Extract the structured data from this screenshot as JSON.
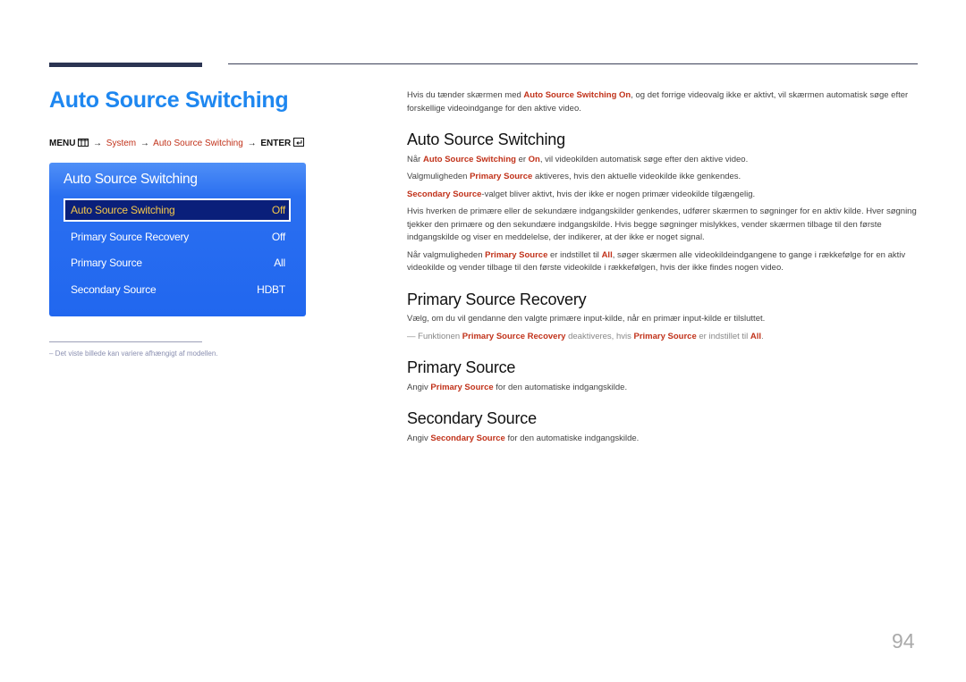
{
  "page_title": "Auto Source Switching",
  "menu_path": {
    "menu": "MENU",
    "system": "System",
    "item": "Auto Source Switching",
    "enter": "ENTER",
    "arrow": "→"
  },
  "osd": {
    "title": "Auto Source Switching",
    "rows": [
      {
        "label": "Auto Source Switching",
        "value": "Off",
        "selected": true
      },
      {
        "label": "Primary Source Recovery",
        "value": "Off"
      },
      {
        "label": "Primary Source",
        "value": "All"
      },
      {
        "label": "Secondary Source",
        "value": "HDBT"
      }
    ]
  },
  "footnote": "‒  Det viste billede kan variere afhængigt af modellen.",
  "intro": {
    "t1": "Hvis du tænder skærmen med ",
    "h1": "Auto Source Switching On",
    "t2": ", og det forrige videovalg ikke er aktivt, vil skærmen automatisk søge efter forskellige videoindgange for den aktive video."
  },
  "sections": {
    "auto": {
      "heading": "Auto Source Switching",
      "p1": {
        "a": "Når ",
        "b": "Auto Source Switching",
        "c": " er ",
        "d": "On",
        "e": ", vil videokilden automatisk søge efter den aktive video."
      },
      "p2": {
        "a": "Valgmuligheden ",
        "b": "Primary Source",
        "c": " aktiveres, hvis den aktuelle videokilde ikke genkendes."
      },
      "p3": {
        "a": "Secondary Source",
        "b": "-valget bliver aktivt, hvis der ikke er nogen primær videokilde tilgængelig."
      },
      "p4": "Hvis hverken de primære eller de sekundære indgangskilder genkendes, udfører skærmen to søgninger for en aktiv kilde. Hver søgning tjekker den primære og den sekundære indgangskilde. Hvis begge søgninger mislykkes, vender skærmen tilbage til den første indgangskilde og viser en meddelelse, der indikerer, at der ikke er noget signal.",
      "p5": {
        "a": "Når valgmuligheden ",
        "b": "Primary Source",
        "c": " er indstillet til ",
        "d": "All",
        "e": ", søger skærmen alle videokildeindgangene to gange i rækkefølge for en aktiv videokilde og vender tilbage til den første videokilde i rækkefølgen, hvis der ikke findes nogen video."
      }
    },
    "recovery": {
      "heading": "Primary Source Recovery",
      "p1": "Vælg, om du vil gendanne den valgte primære input-kilde, når en primær input-kilde er tilsluttet.",
      "note": {
        "dash": "―",
        "a": " Funktionen ",
        "b": "Primary Source Recovery",
        "c": " deaktiveres, hvis ",
        "d": "Primary Source",
        "e": " er indstillet til ",
        "f": "All",
        "g": "."
      }
    },
    "primary": {
      "heading": "Primary Source",
      "p1": {
        "a": "Angiv ",
        "b": "Primary Source",
        "c": " for den automatiske indgangskilde."
      }
    },
    "secondary": {
      "heading": "Secondary Source",
      "p1": {
        "a": "Angiv ",
        "b": "Secondary Source",
        "c": " for den automatiske indgangskilde."
      }
    }
  },
  "page_number": "94",
  "colors": {
    "title_blue": "#1e87f0",
    "highlight_red": "#c1321a",
    "osd_blue": "#2167ef",
    "osd_selected": "#0a1f7a",
    "selected_text": "#f5c84a"
  }
}
